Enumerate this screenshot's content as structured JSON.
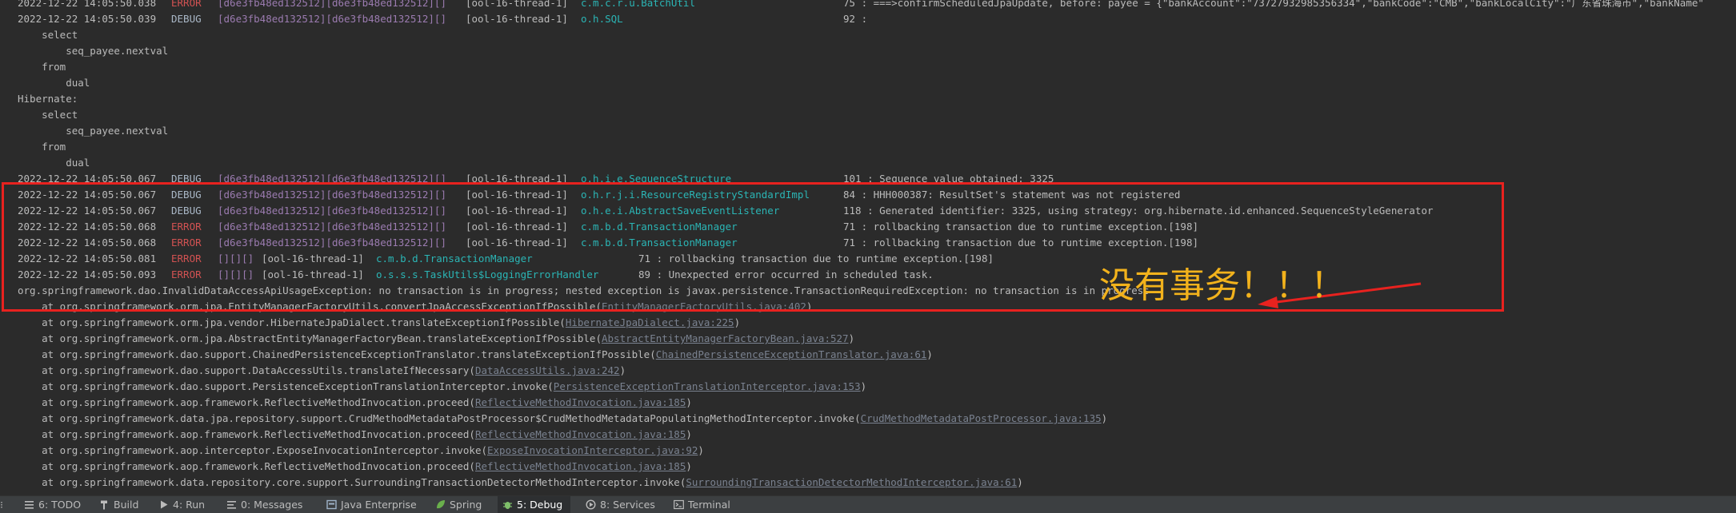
{
  "console": {
    "lines": [
      {
        "date": "2022-12-22 14:05:50.038",
        "level": "ERROR",
        "tids": "[d6e3fb48ed132512][d6e3fb48ed132512][]",
        "thread": "[ool-16-thread-1]",
        "logger": "c.m.c.r.u.BatchUtil",
        "message": "75 : ===>confirmScheduledJpaUpdate, before: payee = {\"bankAccount\":\"73727932985356334\",\"bankCode\":\"CMB\",\"bankLocalCity\":\"广东省珠海市\",\"bankName\""
      },
      {
        "date": "2022-12-22 14:05:50.039",
        "level": "DEBUG",
        "tids": "[d6e3fb48ed132512][d6e3fb48ed132512][]",
        "thread": "[ool-16-thread-1]",
        "logger": "o.h.SQL",
        "message": "92 :"
      },
      {
        "text": "    select"
      },
      {
        "text": "        seq_payee.nextval"
      },
      {
        "text": "    from"
      },
      {
        "text": "        dual"
      },
      {
        "text": "Hibernate:"
      },
      {
        "text": "    select"
      },
      {
        "text": "        seq_payee.nextval"
      },
      {
        "text": "    from"
      },
      {
        "text": "        dual"
      },
      {
        "date": "2022-12-22 14:05:50.067",
        "level": "DEBUG",
        "tids": "[d6e3fb48ed132512][d6e3fb48ed132512][]",
        "thread": "[ool-16-thread-1]",
        "logger": "o.h.i.e.SequenceStructure",
        "message": "101 : Sequence value obtained: 3325"
      },
      {
        "date": "2022-12-22 14:05:50.067",
        "level": "DEBUG",
        "tids": "[d6e3fb48ed132512][d6e3fb48ed132512][]",
        "thread": "[ool-16-thread-1]",
        "logger": "o.h.r.j.i.ResourceRegistryStandardImpl",
        "message": "84 : HHH000387: ResultSet's statement was not registered"
      },
      {
        "date": "2022-12-22 14:05:50.067",
        "level": "DEBUG",
        "tids": "[d6e3fb48ed132512][d6e3fb48ed132512][]",
        "thread": "[ool-16-thread-1]",
        "logger": "o.h.e.i.AbstractSaveEventListener",
        "message": "118 : Generated identifier: 3325, using strategy: org.hibernate.id.enhanced.SequenceStyleGenerator"
      },
      {
        "date": "2022-12-22 14:05:50.068",
        "level": "ERROR",
        "tids": "[d6e3fb48ed132512][d6e3fb48ed132512][]",
        "thread": "[ool-16-thread-1]",
        "logger": "c.m.b.d.TransactionManager",
        "message": "71 : rollbacking transaction due to runtime exception.[198]"
      },
      {
        "date": "2022-12-22 14:05:50.068",
        "level": "ERROR",
        "tids": "[d6e3fb48ed132512][d6e3fb48ed132512][]",
        "thread": "[ool-16-thread-1]",
        "logger": "c.m.b.d.TransactionManager",
        "message": "71 : rollbacking transaction due to runtime exception.[198]"
      },
      {
        "date": "2022-12-22 14:05:50.081",
        "level": "ERROR",
        "tids": "[][][]",
        "thread": "[ool-16-thread-1]",
        "logger": "c.m.b.d.TransactionManager",
        "message": "71 : rollbacking transaction due to runtime exception.[198]"
      },
      {
        "date": "2022-12-22 14:05:50.093",
        "level": "ERROR",
        "tids": "[][][]",
        "thread": "[ool-16-thread-1]",
        "logger": "o.s.s.s.TaskUtils$LoggingErrorHandler",
        "message": "89 : Unexpected error occurred in scheduled task."
      },
      {
        "text": "org.springframework.dao.InvalidDataAccessApiUsageException: no transaction is in progress; nested exception is javax.persistence.TransactionRequiredException: no transaction is in progress"
      },
      {
        "pre": "    at org.springframework.orm.jpa.EntityManagerFactoryUtils.convertJpaAccessExceptionIfPossible(",
        "link": "EntityManagerFactoryUtils.java:402",
        "post": ")"
      },
      {
        "pre": "    at org.springframework.orm.jpa.vendor.HibernateJpaDialect.translateExceptionIfPossible(",
        "link": "HibernateJpaDialect.java:225",
        "post": ")"
      },
      {
        "pre": "    at org.springframework.orm.jpa.AbstractEntityManagerFactoryBean.translateExceptionIfPossible(",
        "link": "AbstractEntityManagerFactoryBean.java:527",
        "post": ")"
      },
      {
        "pre": "    at org.springframework.dao.support.ChainedPersistenceExceptionTranslator.translateExceptionIfPossible(",
        "link": "ChainedPersistenceExceptionTranslator.java:61",
        "post": ")"
      },
      {
        "pre": "    at org.springframework.dao.support.DataAccessUtils.translateIfNecessary(",
        "link": "DataAccessUtils.java:242",
        "post": ")"
      },
      {
        "pre": "    at org.springframework.dao.support.PersistenceExceptionTranslationInterceptor.invoke(",
        "link": "PersistenceExceptionTranslationInterceptor.java:153",
        "post": ")"
      },
      {
        "pre": "    at org.springframework.aop.framework.ReflectiveMethodInvocation.proceed(",
        "link": "ReflectiveMethodInvocation.java:185",
        "post": ")"
      },
      {
        "pre": "    at org.springframework.data.jpa.repository.support.CrudMethodMetadataPostProcessor$CrudMethodMetadataPopulatingMethodInterceptor.invoke(",
        "link": "CrudMethodMetadataPostProcessor.java:135",
        "post": ")"
      },
      {
        "pre": "    at org.springframework.aop.framework.ReflectiveMethodInvocation.proceed(",
        "link": "ReflectiveMethodInvocation.java:185",
        "post": ")"
      },
      {
        "pre": "    at org.springframework.aop.interceptor.ExposeInvocationInterceptor.invoke(",
        "link": "ExposeInvocationInterceptor.java:92",
        "post": ")"
      },
      {
        "pre": "    at org.springframework.aop.framework.ReflectiveMethodInvocation.proceed(",
        "link": "ReflectiveMethodInvocation.java:185",
        "post": ")"
      },
      {
        "pre": "    at org.springframework.data.repository.core.support.SurroundingTransactionDetectorMethodInterceptor.invoke(",
        "link": "SurroundingTransactionDetectorMethodInterceptor.java:61",
        "post": ")"
      }
    ]
  },
  "annotation": {
    "text": "没有事务！！！",
    "color": "#f2b21c",
    "box_color": "#e8221f"
  },
  "colors": {
    "background": "#2b2b2b",
    "debug": "#a9b7c6",
    "error": "#d25252",
    "logger": "#2bb5b5",
    "tids": "#9b7bb0",
    "link": "#7a8290"
  },
  "tool_tabs": [
    {
      "label": "6: TODO",
      "icon": "todo-icon",
      "active": false
    },
    {
      "label": "Build",
      "icon": "hammer-icon",
      "active": false
    },
    {
      "label": "4: Run",
      "icon": "run-icon",
      "active": false
    },
    {
      "label": "0: Messages",
      "icon": "messages-icon",
      "active": false
    },
    {
      "label": "Java Enterprise",
      "icon": "java-enterprise-icon",
      "active": false
    },
    {
      "label": "Spring",
      "icon": "spring-icon",
      "active": false
    },
    {
      "label": "5: Debug",
      "icon": "bug-icon",
      "active": true
    },
    {
      "label": "8: Services",
      "icon": "services-icon",
      "active": false
    },
    {
      "label": "Terminal",
      "icon": "terminal-icon",
      "active": false
    }
  ]
}
